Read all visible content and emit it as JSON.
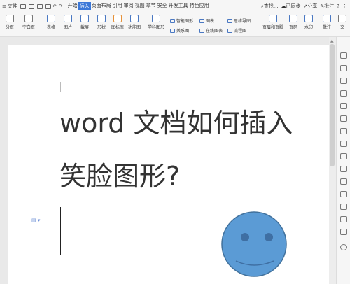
{
  "topbar": {
    "file_menu": "文件",
    "tabs": [
      "开始",
      "插入",
      "页面布局",
      "引用",
      "审阅",
      "视图",
      "章节",
      "安全",
      "开发工具",
      "特色应用"
    ],
    "active_tab": "插入",
    "search": "查找...",
    "sync": "已同步",
    "share": "分享",
    "comment": "批注",
    "help": "?"
  },
  "ribbon": {
    "page_break": "分页",
    "blank_page": "空白页",
    "table": "表格",
    "picture": "图片",
    "screenshot": "截屏",
    "shapes": "形状",
    "icon_lib": "图标库",
    "func_chart": "功能图",
    "sci_shape": "学科图形",
    "smart_shape": "智能图形",
    "chart": "图表",
    "mindmap": "思维导图",
    "relation": "关系图",
    "online_chart": "在线图表",
    "flowchart": "流程图",
    "header_footer": "页眉和页脚",
    "page_number": "页码",
    "watermark": "水印",
    "comment": "批注",
    "text": "文"
  },
  "document": {
    "line1": "word 文档如何插入",
    "line2": "笑脸图形?"
  },
  "colors": {
    "smiley_fill": "#5b9bd5",
    "smiley_stroke": "#41719c",
    "active_tab": "#3c78d8"
  }
}
